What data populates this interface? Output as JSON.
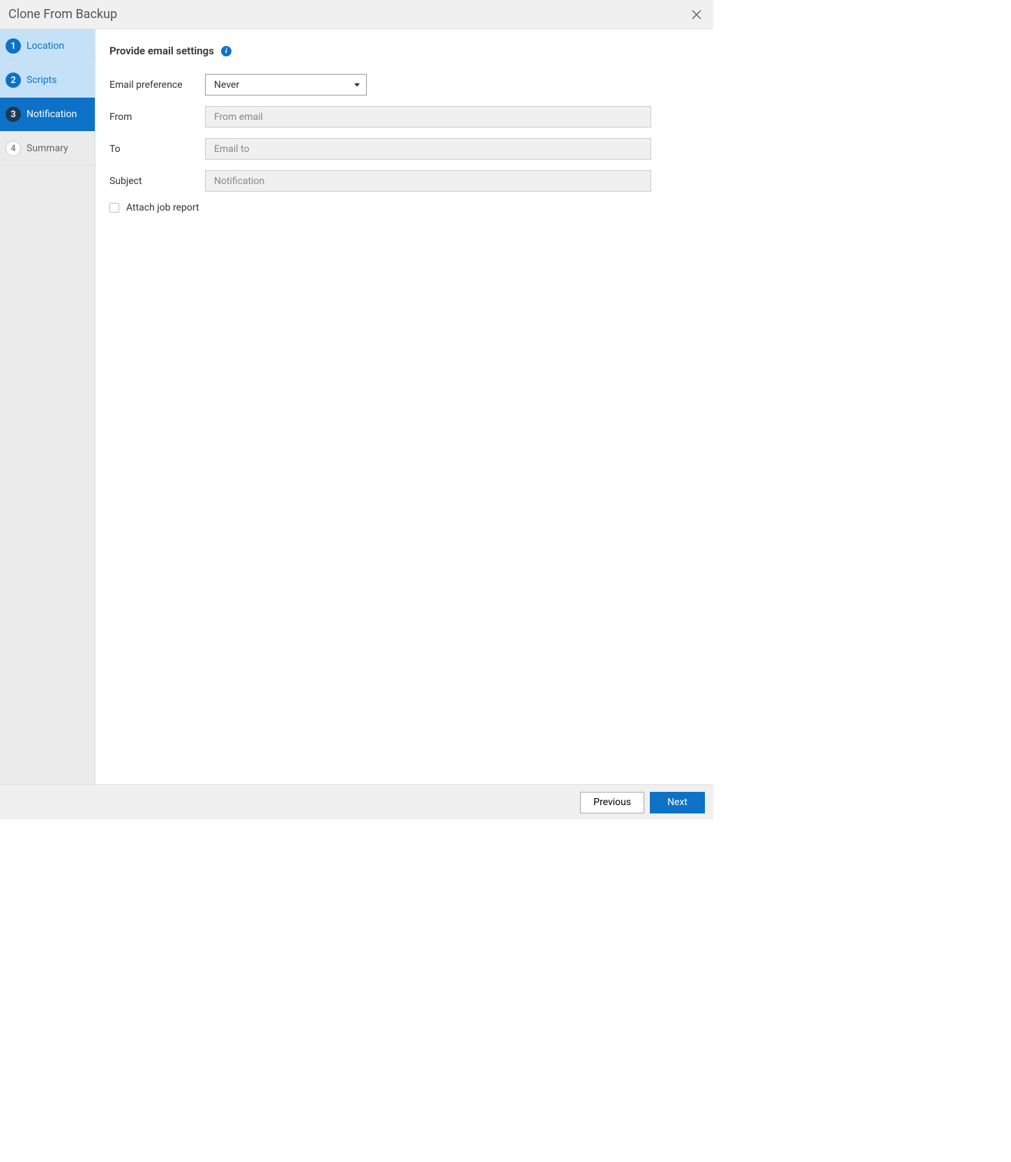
{
  "dialog": {
    "title": "Clone From Backup"
  },
  "sidebar": {
    "steps": [
      {
        "num": "1",
        "label": "Location"
      },
      {
        "num": "2",
        "label": "Scripts"
      },
      {
        "num": "3",
        "label": "Notification"
      },
      {
        "num": "4",
        "label": "Summary"
      }
    ]
  },
  "main": {
    "section_title": "Provide email settings",
    "labels": {
      "email_preference": "Email preference",
      "from": "From",
      "to": "To",
      "subject": "Subject",
      "attach_report": "Attach job report"
    },
    "values": {
      "email_preference": "Never"
    },
    "placeholders": {
      "from": "From email",
      "to": "Email to",
      "subject": "Notification"
    }
  },
  "footer": {
    "previous": "Previous",
    "next": "Next"
  }
}
